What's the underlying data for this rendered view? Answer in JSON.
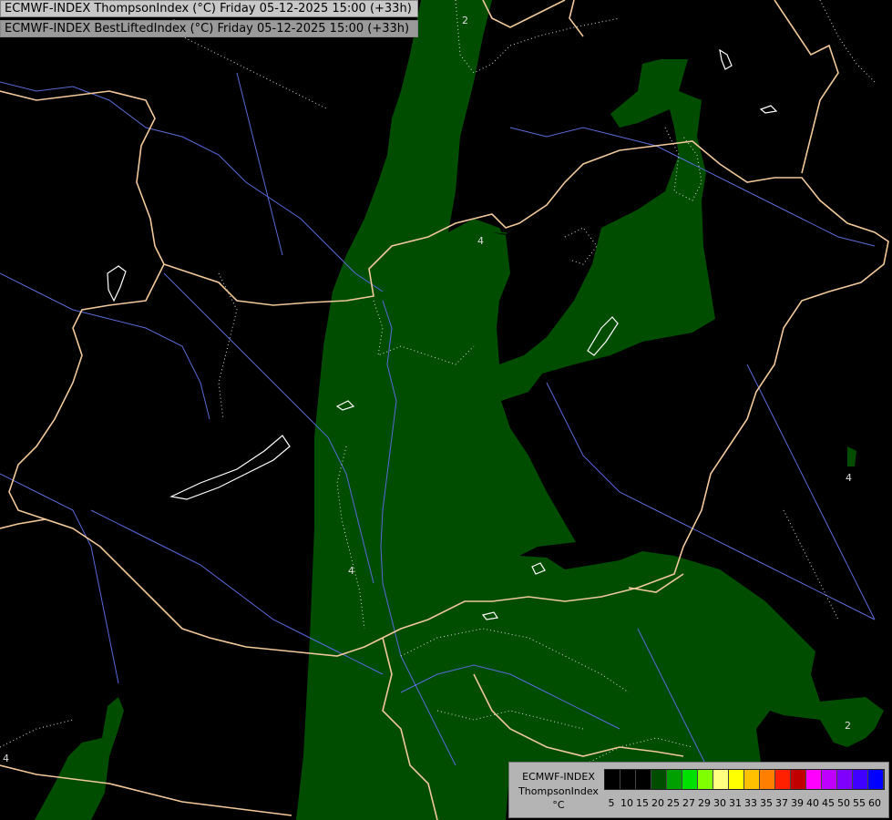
{
  "header": {
    "line1": "ECMWF-INDEX ThompsonIndex (°C) Friday 05-12-2025 15:00 (+33h)",
    "line2": "ECMWF-INDEX BestLiftedIndex (°C) Friday 05-12-2025 15:00 (+33h)"
  },
  "map": {
    "contour_labels": [
      "2",
      "4",
      "4",
      "4",
      "4",
      "2"
    ],
    "colors": {
      "background": "#000000",
      "fill_index_20_25": "#004d00",
      "fill_index_25_27": "#007a00",
      "borders": "#f0c89a",
      "rivers": "#5a6ad8",
      "contours": "#dcdcdc"
    }
  },
  "legend": {
    "title_lines": [
      "ECMWF-INDEX",
      "ThompsonIndex",
      "°C"
    ],
    "tick_labels": [
      "5",
      "10",
      "15",
      "20",
      "25",
      "27",
      "29",
      "30",
      "31",
      "33",
      "35",
      "37",
      "39",
      "40",
      "45",
      "50",
      "55",
      "60"
    ],
    "colors": [
      "#000000",
      "#000000",
      "#000000",
      "#004d00",
      "#00a000",
      "#00e000",
      "#80ff00",
      "#ffff80",
      "#ffff00",
      "#ffc000",
      "#ff8000",
      "#ff2000",
      "#c00000",
      "#ff00ff",
      "#c000ff",
      "#8000ff",
      "#4000ff",
      "#0000ff"
    ]
  }
}
